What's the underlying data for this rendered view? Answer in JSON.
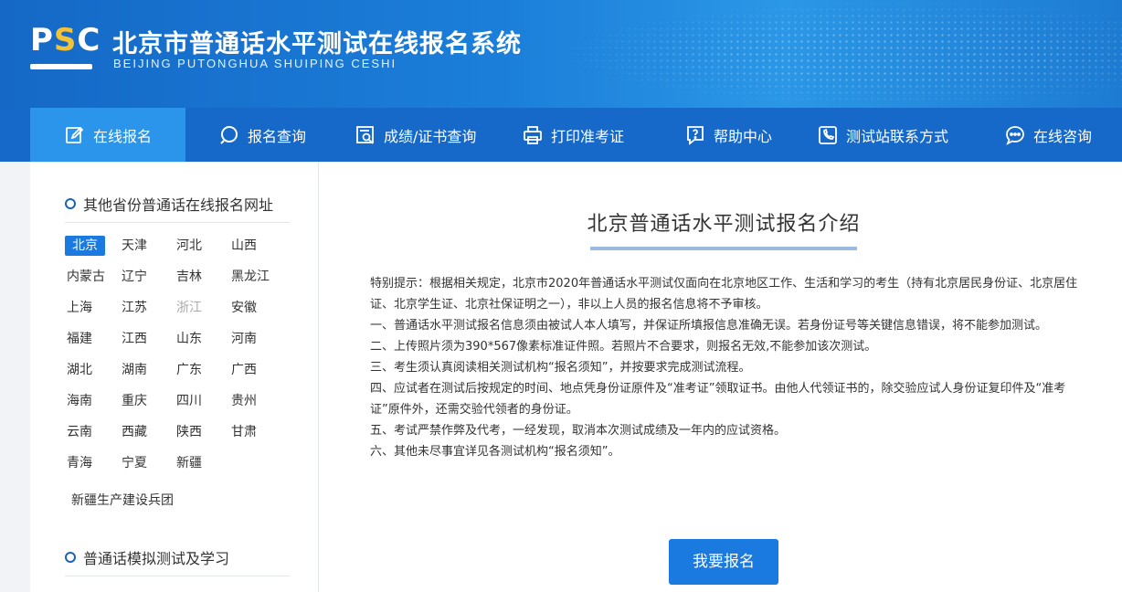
{
  "header": {
    "logo_text_p": "P",
    "logo_text_s": "S",
    "logo_text_c": "C",
    "title_cn": "北京市普通话水平测试在线报名系统",
    "title_en": "BEIJING PUTONGHUA SHUIPING CESHI"
  },
  "nav": {
    "items": [
      {
        "label": "在线报名",
        "icon": "edit-icon"
      },
      {
        "label": "报名查询",
        "icon": "search-icon"
      },
      {
        "label": "成绩/证书查询",
        "icon": "certificate-search-icon"
      },
      {
        "label": "打印准考证",
        "icon": "printer-icon"
      },
      {
        "label": "帮助中心",
        "icon": "help-icon"
      },
      {
        "label": "测试站联系方式",
        "icon": "phone-icon"
      },
      {
        "label": "在线咨询",
        "icon": "chat-icon"
      }
    ]
  },
  "sidebar": {
    "section1_title": "其他省份普通话在线报名网址",
    "provinces": [
      "北京",
      "天津",
      "河北",
      "山西",
      "内蒙古",
      "辽宁",
      "吉林",
      "黑龙江",
      "上海",
      "江苏",
      "浙江",
      "安徽",
      "福建",
      "江西",
      "山东",
      "河南",
      "湖北",
      "湖南",
      "广东",
      "广西",
      "海南",
      "重庆",
      "四川",
      "贵州",
      "云南",
      "西藏",
      "陕西",
      "甘肃",
      "青海",
      "宁夏",
      "新疆"
    ],
    "extra": "新疆生产建设兵团",
    "section2_title": "普通话模拟测试及学习"
  },
  "main": {
    "title": "北京普通话水平测试报名介绍",
    "paragraphs": [
      "特别提示：根据相关规定，北京市2020年普通话水平测试仅面向在北京地区工作、生活和学习的考生（持有北京居民身份证、北京居住证、北京学生证、北京社保证明之一），非以上人员的报名信息将不予审核。",
      "一、普通话水平测试报名信息须由被试人本人填写，并保证所填报信息准确无误。若身份证号等关键信息错误，将不能参加测试。",
      "二、上传照片须为390*567像素标准证件照。若照片不合要求，则报名无效,不能参加该次测试。",
      "三、考生须认真阅读相关测试机构“报名须知”，并按要求完成测试流程。",
      "四、应试者在测试后按规定的时间、地点凭身份证原件及“准考证”领取证书。由他人代领证书的，除交验应试人身份证复印件及“准考证”原件外，还需交验代领者的身份证。",
      "五、考试严禁作弊及代考，一经发现，取消本次测试成绩及一年内的应试资格。",
      "六、其他未尽事宜详见各测试机构“报名须知”。"
    ],
    "button_label": "我要报名"
  },
  "colors": {
    "nav_bg": "#1669c8",
    "nav_active": "#2a95ea",
    "accent": "#1a7ae0",
    "logo_s": "#f3c23b"
  }
}
